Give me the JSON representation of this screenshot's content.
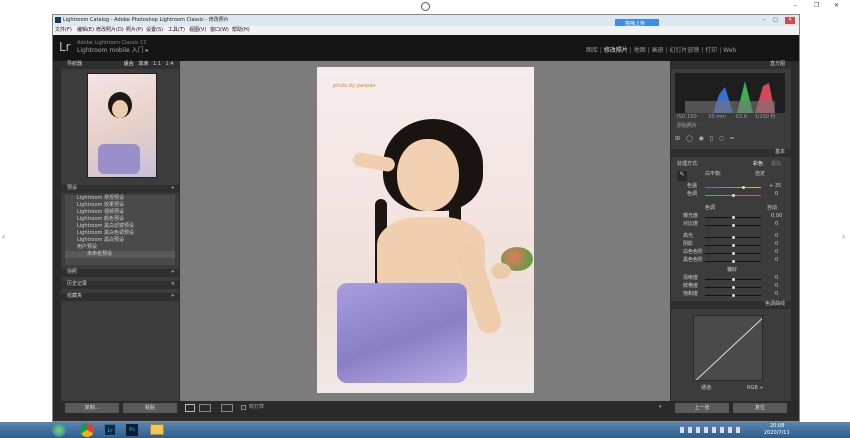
{
  "outer_center_icon": "loading-icon",
  "outer_controls": [
    "–",
    "❐",
    "✕"
  ],
  "window": {
    "title": "Lightroom Catalog - Adobe Photoshop Lightroom Classic - 修改照片",
    "controls": [
      "–",
      "□",
      "✕"
    ],
    "menu": [
      "文件(F)",
      "编辑(E)",
      "修改照片(D)",
      "照片(P)",
      "设置(S)",
      "工具(T)",
      "视图(V)",
      "窗口(W)",
      "帮助(H)"
    ],
    "upload_button": "拖拽上传",
    "logo": "Lr",
    "brand_line1": "Adobe Lightroom Classic CC",
    "brand_line2": "Lightroom mobile 入门 ▸",
    "modules": [
      "图库",
      "修改照片",
      "地图",
      "画册",
      "幻灯片放映",
      "打印",
      "Web"
    ],
    "active_module": "修改照片"
  },
  "left": {
    "navigator": {
      "title": "导航器",
      "opts": [
        "适合",
        "填满",
        "1:1",
        "1:4",
        "▾"
      ]
    },
    "presets": {
      "title": "预设",
      "items": [
        "Lightroom 常规预设",
        "Lightroom 效果预设",
        "Lightroom 视频预设",
        "Lightroom 颜色预设",
        "Lightroom 黑白滤镜预设",
        "Lightroom 黑白色调预设",
        "Lightroom 黑白预设",
        "用户预设",
        "未命名预设"
      ]
    },
    "snapshots": "快照",
    "history": "历史记录",
    "collections": "收藏夹",
    "copy_btn": "复制...",
    "paste_btn": "粘贴"
  },
  "center": {
    "watermark": "photo by panpan"
  },
  "right": {
    "histogram": {
      "title": "直方图",
      "info": [
        "ISO 100",
        "50 mm",
        "f/2.8",
        "1/200 秒"
      ],
      "orig": "原始照片"
    },
    "basic": {
      "title": "基本",
      "treatment_label": "处理方式:",
      "treatment_options": [
        "彩色",
        "黑白"
      ],
      "wb_label": "白平衡:",
      "wb_value": "自定",
      "temp_label": "色温",
      "temp_value": "+ 35",
      "tint_label": "色调",
      "tint_value": "0",
      "tone_label": "色调",
      "auto_label": "自动",
      "tone_rows": [
        {
          "label": "曝光度",
          "value": "0.00"
        },
        {
          "label": "对比度",
          "value": "0"
        },
        {
          "label": "高光",
          "value": "0"
        },
        {
          "label": "阴影",
          "value": "0"
        },
        {
          "label": "白色色阶",
          "value": "0"
        },
        {
          "label": "黑色色阶",
          "value": "0"
        }
      ],
      "presence_label": "偏好",
      "presence_rows": [
        {
          "label": "清晰度",
          "value": "0"
        },
        {
          "label": "鲜艳度",
          "value": "0"
        },
        {
          "label": "饱和度",
          "value": "0"
        }
      ]
    },
    "tone_curve": {
      "title": "色调曲线",
      "channel_label": "通道:",
      "channel": "RGB ÷"
    },
    "prev_btn": "上一张",
    "reset_btn": "复位"
  },
  "toolbar": {
    "softproof": "软打样"
  },
  "taskbar": {
    "apps": [
      "start-orb-icon",
      "chrome-icon",
      "lightroom-icon",
      "photoshop-icon",
      "explorer-icon"
    ],
    "app_labels": {
      "lightroom": "Lr",
      "photoshop": "Ps"
    },
    "time": "20:08",
    "date": "2020/7/11"
  }
}
